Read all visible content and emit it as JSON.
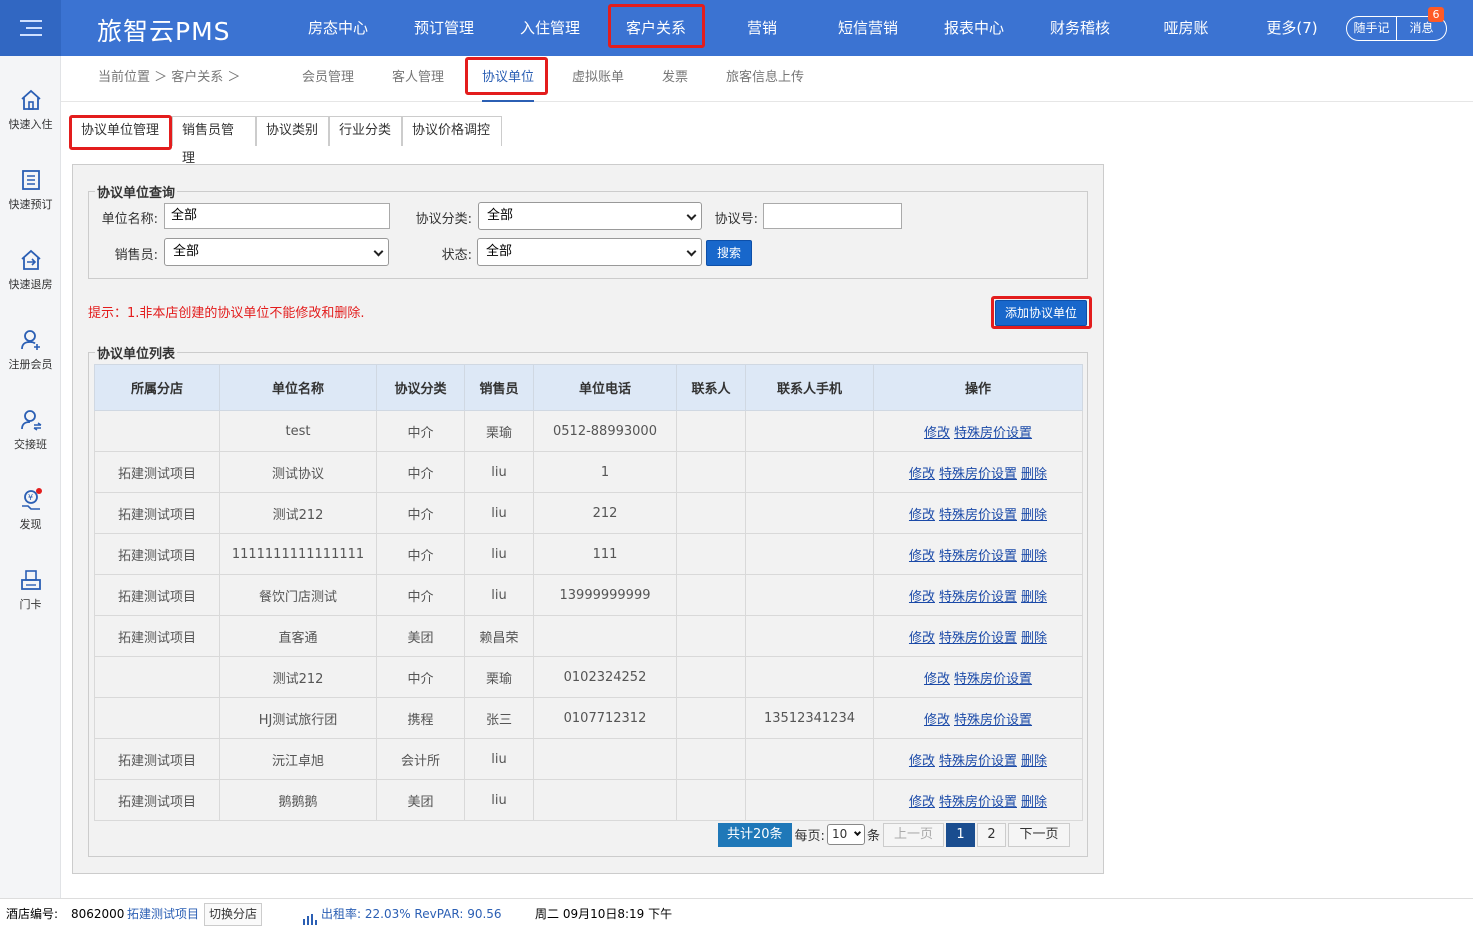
{
  "header": {
    "logo": "旅智云PMS",
    "nav": [
      "房态中心",
      "预订管理",
      "入住管理",
      "客户关系",
      "营销",
      "短信营销",
      "报表中心",
      "财务稽核",
      "哑房账",
      "更多(7)"
    ],
    "quick_note": "随手记",
    "messages": "消息",
    "message_count": "6"
  },
  "sidebar": {
    "items": [
      "快速入住",
      "快速预订",
      "快速退房",
      "注册会员",
      "交接班",
      "发现",
      "门卡"
    ]
  },
  "subnav": {
    "breadcrumb": "当前位置 ＞ 客户关系 ＞",
    "items": [
      "会员管理",
      "客人管理",
      "协议单位",
      "虚拟账单",
      "发票",
      "旅客信息上传"
    ]
  },
  "tabs": [
    "协议单位管理",
    "销售员管理",
    "协议类别",
    "行业分类",
    "协议价格调控"
  ],
  "query": {
    "legend": "协议单位查询",
    "unit_name_label": "单位名称:",
    "unit_name_value": "全部",
    "category_label": "协议分类:",
    "category_value": "全部",
    "agreement_no_label": "协议号:",
    "agreement_no_value": "",
    "salesman_label": "销售员:",
    "salesman_value": "全部",
    "status_label": "状态:",
    "status_value": "全部",
    "search_button": "搜索"
  },
  "hint": "提示：1.非本店创建的协议单位不能修改和删除.",
  "add_button": "添加协议单位",
  "list": {
    "legend": "协议单位列表",
    "columns": [
      "所属分店",
      "单位名称",
      "协议分类",
      "销售员",
      "单位电话",
      "联系人",
      "联系人手机",
      "操作"
    ],
    "rows": [
      {
        "branch": "",
        "name": "test",
        "category": "中介",
        "sales": "栗瑜",
        "phone": "0512-88993000",
        "contact": "",
        "mobile": "",
        "deletable": false
      },
      {
        "branch": "拓建测试项目",
        "name": "测试协议",
        "category": "中介",
        "sales": "liu",
        "phone": "1",
        "contact": "",
        "mobile": "",
        "deletable": true
      },
      {
        "branch": "拓建测试项目",
        "name": "测试212",
        "category": "中介",
        "sales": "liu",
        "phone": "212",
        "contact": "",
        "mobile": "",
        "deletable": true
      },
      {
        "branch": "拓建测试项目",
        "name": "1111111111111111",
        "category": "中介",
        "sales": "liu",
        "phone": "111",
        "contact": "",
        "mobile": "",
        "deletable": true
      },
      {
        "branch": "拓建测试项目",
        "name": "餐饮门店测试",
        "category": "中介",
        "sales": "liu",
        "phone": "13999999999",
        "contact": "",
        "mobile": "",
        "deletable": true
      },
      {
        "branch": "拓建测试项目",
        "name": "直客通",
        "category": "美团",
        "sales": "赖昌荣",
        "phone": "",
        "contact": "",
        "mobile": "",
        "deletable": true
      },
      {
        "branch": "",
        "name": "测试212",
        "category": "中介",
        "sales": "栗瑜",
        "phone": "0102324252",
        "contact": "",
        "mobile": "",
        "deletable": false
      },
      {
        "branch": "",
        "name": "HJ测试旅行团",
        "category": "携程",
        "sales": "张三",
        "phone": "0107712312",
        "contact": "",
        "mobile": "13512341234",
        "deletable": false
      },
      {
        "branch": "拓建测试项目",
        "name": "沅江卓旭",
        "category": "会计所",
        "sales": "liu",
        "phone": "",
        "contact": "",
        "mobile": "",
        "deletable": true
      },
      {
        "branch": "拓建测试项目",
        "name": "鹅鹅鹅",
        "category": "美团",
        "sales": "liu",
        "phone": "",
        "contact": "",
        "mobile": "",
        "deletable": true
      }
    ],
    "actions": {
      "edit": "修改",
      "special_price": "特殊房价设置",
      "delete": "删除"
    }
  },
  "pager": {
    "total": "共计20条",
    "per_page_label": "每页:",
    "per_page_value": "10",
    "per_page_unit": "条",
    "prev": "上一页",
    "pages": [
      "1",
      "2"
    ],
    "current": "1",
    "next": "下一页"
  },
  "footer": {
    "hotel_code_label": "酒店编号:",
    "hotel_code": "8062000",
    "hotel_name": "拓建测试项目",
    "switch_branch": "切换分店",
    "occupancy": "出租率: 22.03% RevPAR: 90.56",
    "datetime": "周二 09月10日8:19 下午"
  },
  "colors": {
    "header": "#3b73d2",
    "highlight": "#e31d1d",
    "button": "#1867cb",
    "link": "#1b4aa8"
  }
}
